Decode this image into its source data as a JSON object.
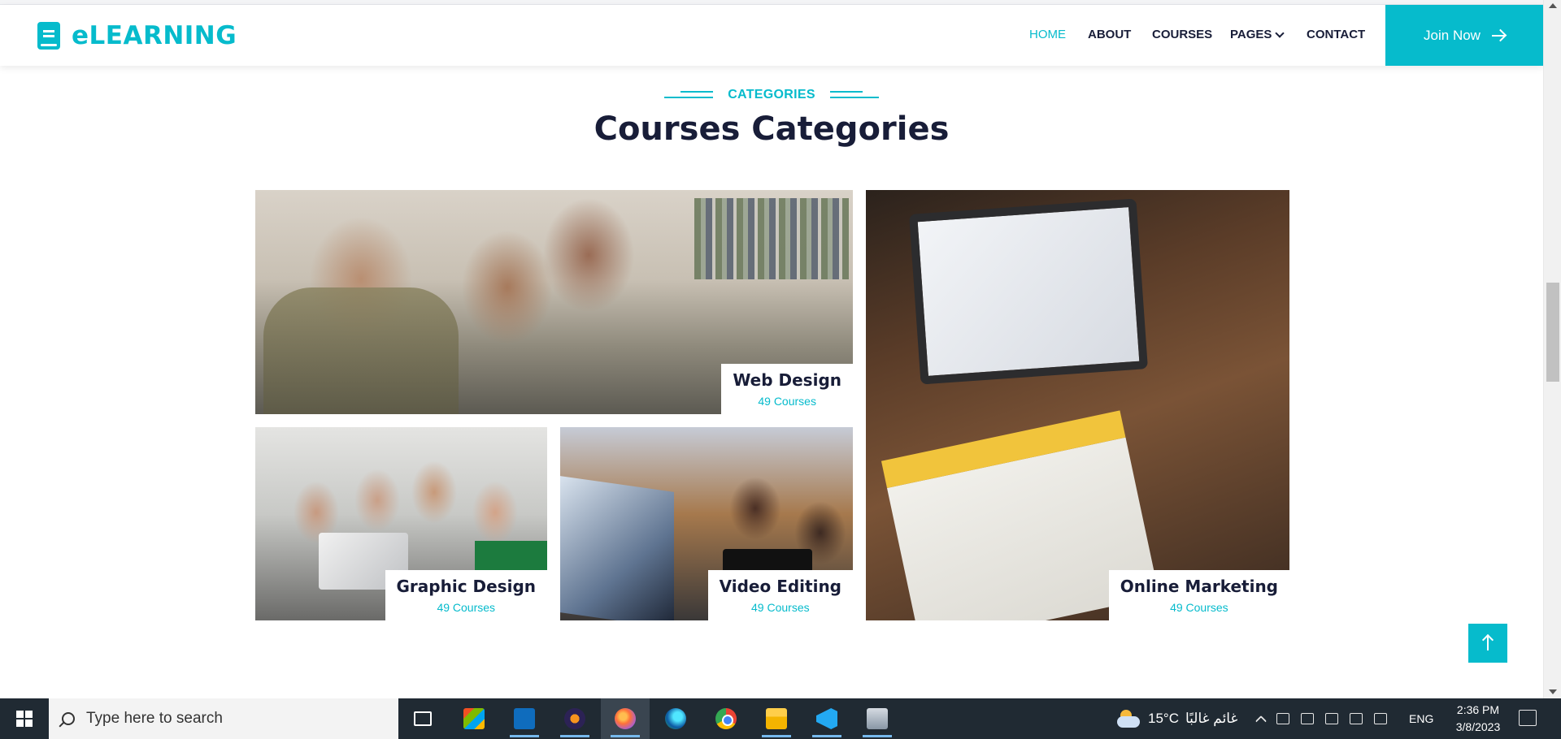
{
  "brand": {
    "name": "eLEARNING"
  },
  "nav": {
    "home": "HOME",
    "about": "ABOUT",
    "courses": "COURSES",
    "pages": "PAGES",
    "contact": "CONTACT",
    "join": "Join Now"
  },
  "section": {
    "eyebrow": "CATEGORIES",
    "title": "Courses Categories"
  },
  "categories": [
    {
      "title": "Web Design",
      "count": "49 Courses"
    },
    {
      "title": "Graphic Design",
      "count": "49 Courses"
    },
    {
      "title": "Video Editing",
      "count": "49 Courses"
    },
    {
      "title": "Online Marketing",
      "count": "49 Courses"
    }
  ],
  "taskbar": {
    "search_placeholder": "Type here to search",
    "weather_temp": "15°C",
    "weather_desc": "غائم غالبًا",
    "lang": "ENG",
    "time": "2:36 PM",
    "date": "3/8/2023"
  },
  "colors": {
    "accent": "#06bbcc",
    "heading": "#181d38",
    "taskbar": "#202a33"
  }
}
